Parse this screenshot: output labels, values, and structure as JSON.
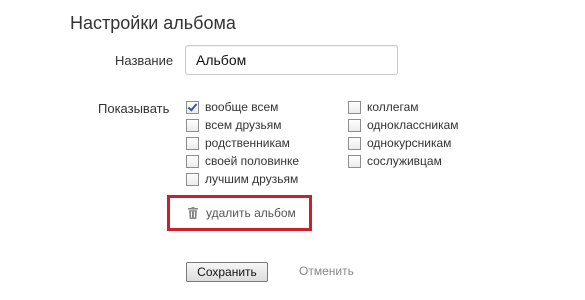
{
  "page": {
    "title": "Настройки альбома"
  },
  "name_field": {
    "label": "Название",
    "value": "Альбом"
  },
  "visibility": {
    "label": "Показывать",
    "left_options": [
      {
        "label": "вообще всем",
        "checked": true
      },
      {
        "label": "всем друзьям",
        "checked": false
      },
      {
        "label": "родственникам",
        "checked": false
      },
      {
        "label": "своей половинке",
        "checked": false
      },
      {
        "label": "лучшим друзьям",
        "checked": false
      }
    ],
    "right_options": [
      {
        "label": "коллегам",
        "checked": false
      },
      {
        "label": "одноклассникам",
        "checked": false
      },
      {
        "label": "однокурсникам",
        "checked": false
      },
      {
        "label": "сослуживцам",
        "checked": false
      }
    ]
  },
  "delete": {
    "label": "удалить альбом",
    "icon": "trash-icon",
    "highlight_color": "#c9202b"
  },
  "actions": {
    "save_label": "Сохранить",
    "cancel_label": "Отменить"
  }
}
